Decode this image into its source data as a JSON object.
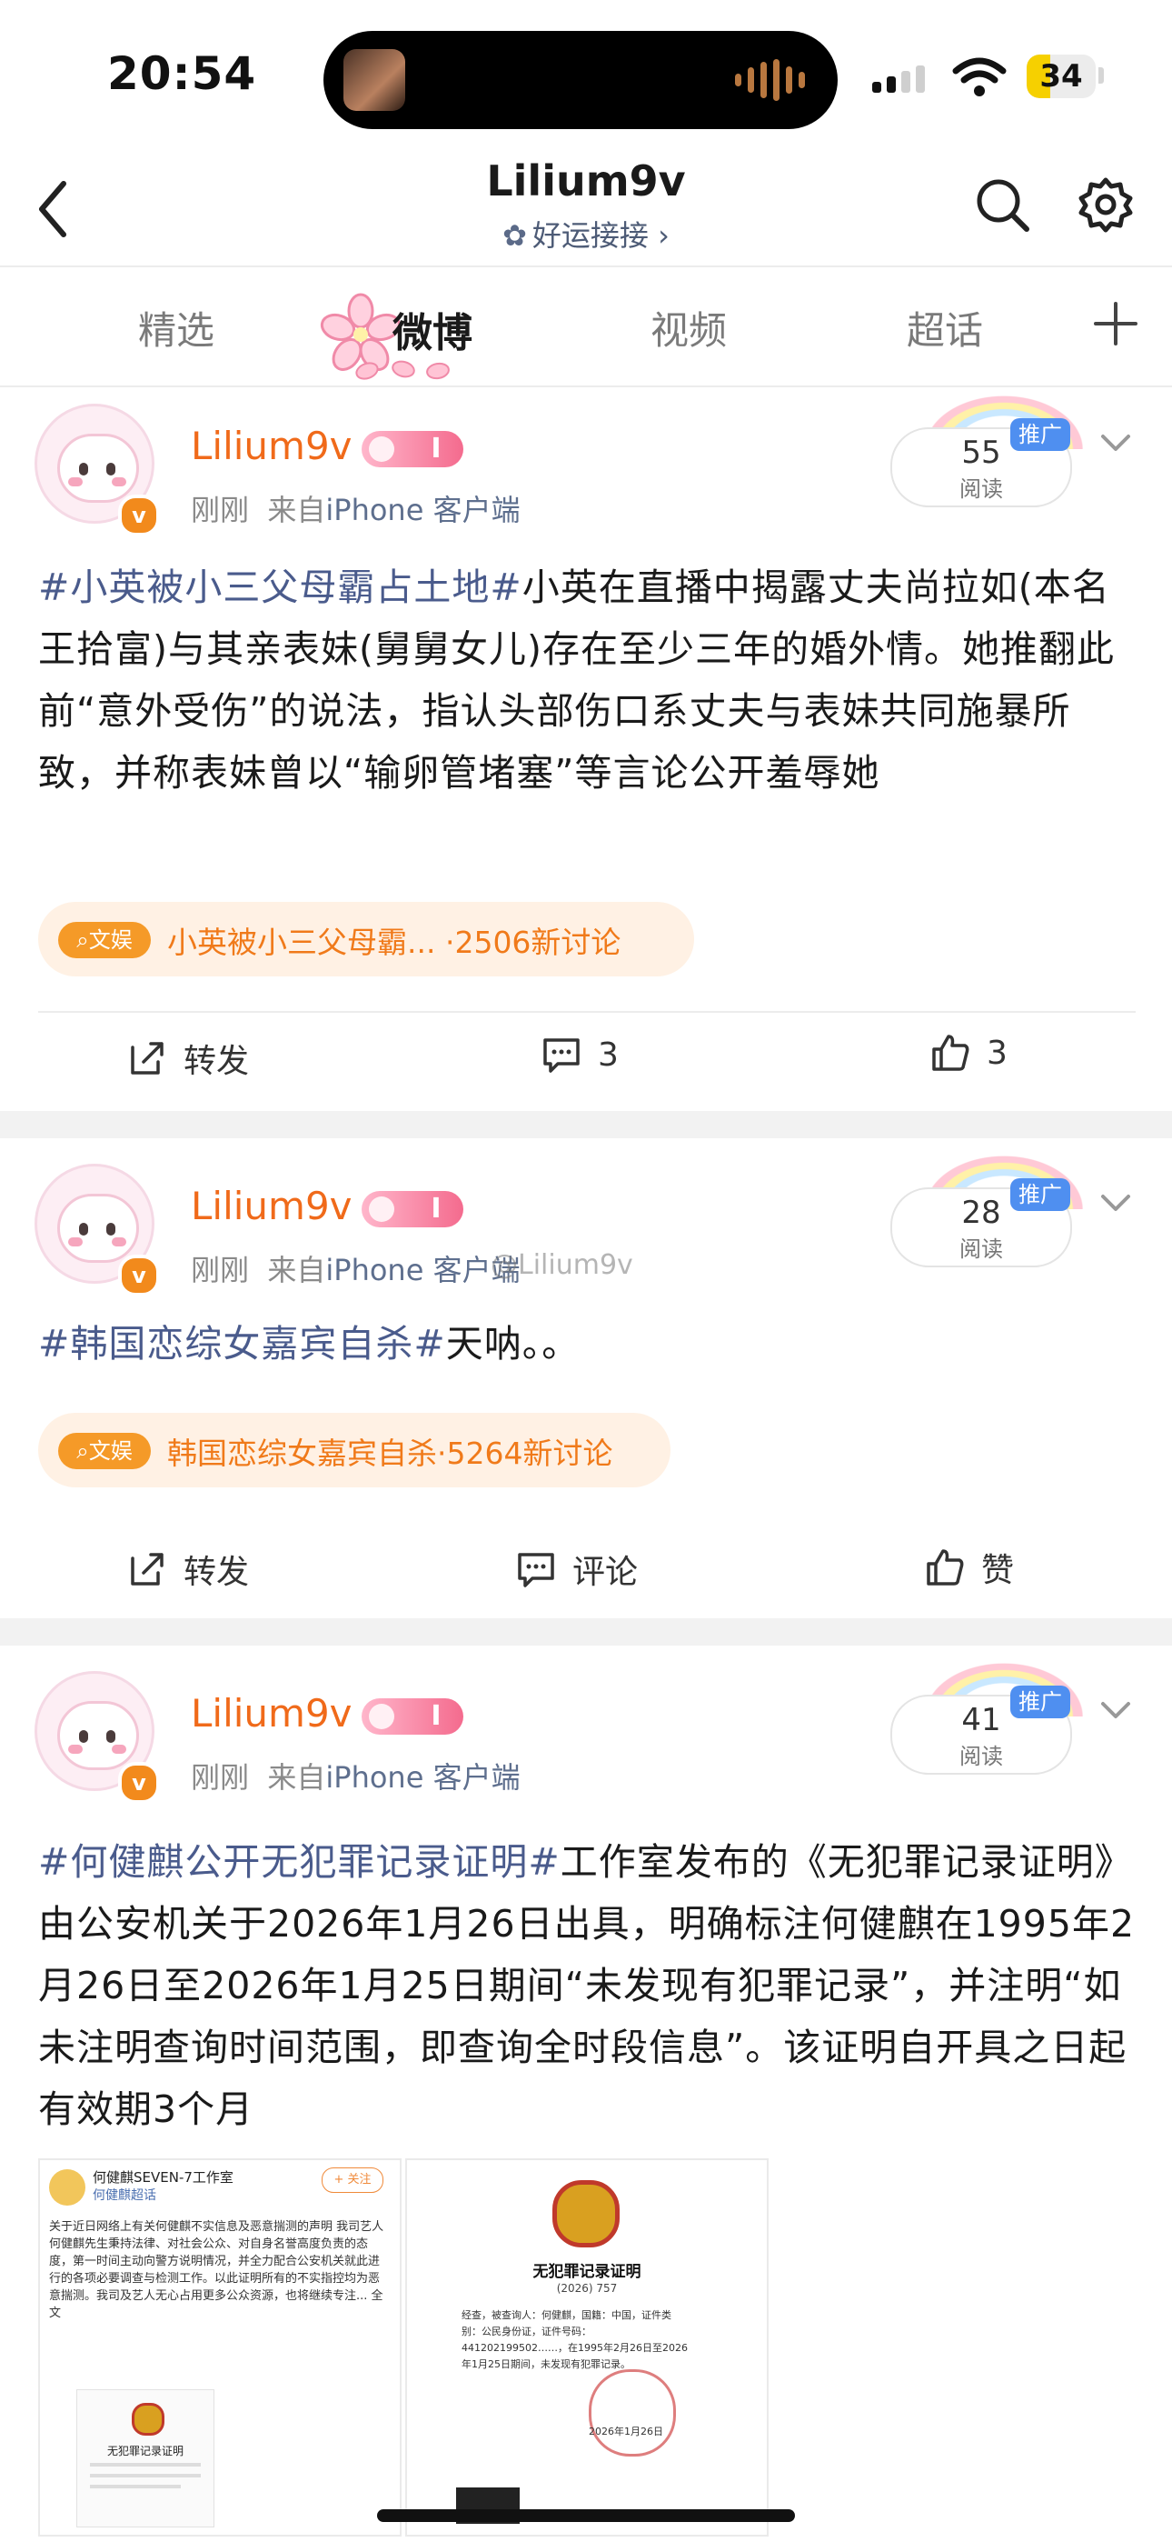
{
  "status_bar": {
    "time": "20:54",
    "battery": "34",
    "battery_level_percent": 34
  },
  "header": {
    "title": "Lilium9v",
    "subtitle": "好运接接 ›",
    "subtitle_icon": "clover-icon"
  },
  "tabs": [
    {
      "label": "精选",
      "active": false
    },
    {
      "label": "微博",
      "active": true
    },
    {
      "label": "视频",
      "active": false
    },
    {
      "label": "超话",
      "active": false
    }
  ],
  "posts": [
    {
      "username": "Lilium9v",
      "rank": "I",
      "time": "刚刚",
      "source_prefix": "来自",
      "source": "iPhone 客户端",
      "ad_label": "推广",
      "read_count": "55",
      "read_label": "阅读",
      "tag": "#小英被小三父母霸占土地#",
      "text": "小英在直播中揭露丈夫尚拉如(本名王拾富)与其亲表妹(舅舅女儿)存在至少三年的婚外情。她推翻此前“意外受伤”的说法，指认头部伤口系丈夫与表妹共同施暴所致，并称表妹曾以“输卵管堵塞”等言论公开羞辱她",
      "topic_badge": "文娱",
      "topic_text": "小英被小三父母霸...  ·2506新讨论",
      "actions": {
        "repost": "转发",
        "comment": "3",
        "like": "3"
      }
    },
    {
      "username": "Lilium9v",
      "rank": "I",
      "time": "刚刚",
      "source_prefix": "来自",
      "source": "iPhone 客户端",
      "ad_label": "推广",
      "read_count": "28",
      "read_label": "阅读",
      "tag": "#韩国恋综女嘉宾自杀#",
      "text": "天呐。。",
      "topic_badge": "文娱",
      "topic_text": "韩国恋综女嘉宾自杀·5264新讨论",
      "actions": {
        "repost": "转发",
        "comment": "评论",
        "like": "赞"
      },
      "watermark": "@Lilium9v"
    },
    {
      "username": "Lilium9v",
      "rank": "I",
      "time": "刚刚",
      "source_prefix": "来自",
      "source": "iPhone 客户端",
      "ad_label": "推广",
      "read_count": "41",
      "read_label": "阅读",
      "tag": "#何健麒公开无犯罪记录证明#",
      "text": "工作室发布的《无犯罪记录证明》由公安机关于2026年1月26日出具，明确标注何健麒在1995年2月26日至2026年1月25日期间“未发现有犯罪记录”，并注明“如未注明查询时间范围，即查询全时段信息”。该证明自开具之日起有效期3个月",
      "images": [
        {
          "account": "何健麒SEVEN-7工作室",
          "account_sub": "何健麒超话",
          "follow": "+ 关注",
          "body": "关于近日网络上有关何健麒不实信息及恶意揣测的声明 我司艺人何健麒先生秉持法律、对社会公众、对自身名誉高度负责的态度，第一时间主动向警方说明情况，并全力配合公安机关就此进行的各项必要调查与检测工作。以此证明所有的不实指控均为恶意揣测。我司及艺人无心占用更多公众资源，也将继续专注... 全文",
          "doc_title": "无犯罪记录证明"
        },
        {
          "doc_title": "无犯罪记录证明",
          "doc_no": "(2026) 757",
          "doc_body": "经查，被查询人：何健麒，国籍：中国，证件类别：公民身份证，证件号码：441202199502……，在1995年2月26日至2026年1月25日期间，未发现有犯罪记录。",
          "doc_date": "2026年1月26日"
        }
      ]
    }
  ],
  "colors": {
    "username": "#f06a1a",
    "tag": "#4a5b8c",
    "topic_bg": "#fff1e4",
    "topic_badge": "#f59a28",
    "ad_pill": "#4f8ff0"
  }
}
